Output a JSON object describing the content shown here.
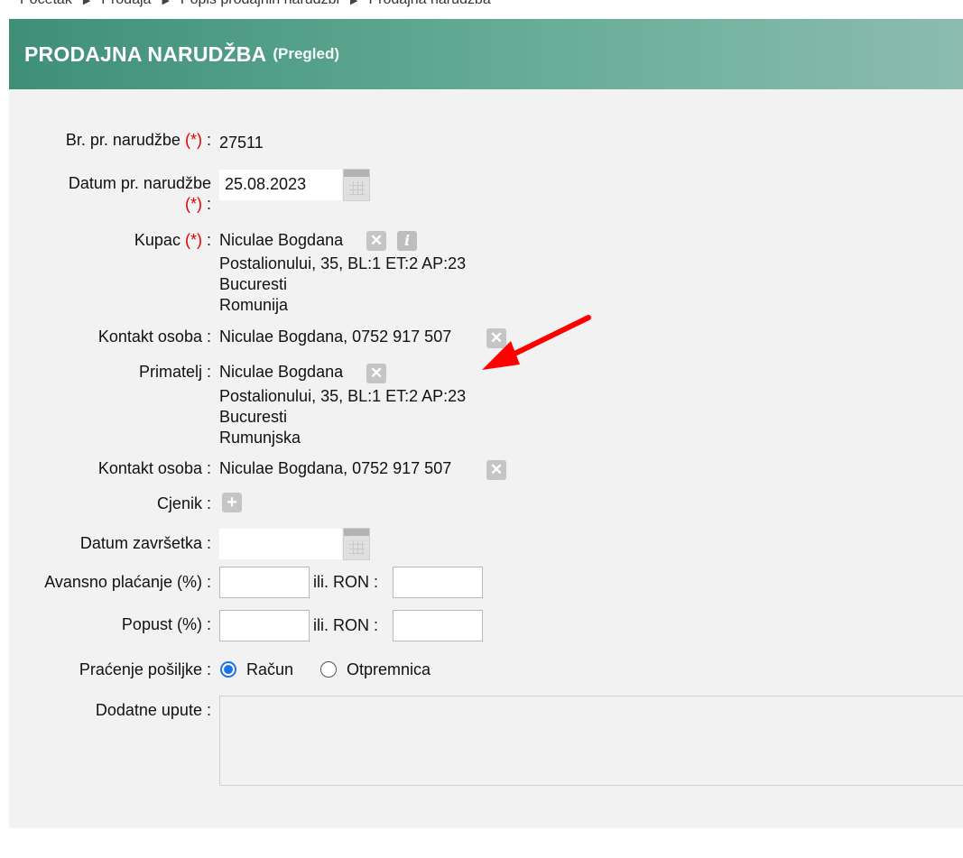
{
  "breadcrumb": [
    "Početak",
    "Prodaja",
    "Popis prodajnih narudžbi",
    "Prodajna narudžba"
  ],
  "header": {
    "title": "PRODAJNA NARUDŽBA",
    "mode": "(Pregled)"
  },
  "form": {
    "order_no": {
      "label": "Br. pr. narudžbe",
      "required": "(*)",
      "value": "27511"
    },
    "order_date": {
      "label_line1": "Datum pr. narudžbe",
      "required": "(*)",
      "value": "25.08.2023"
    },
    "customer": {
      "label": "Kupac",
      "required": "(*)",
      "name": "Niculae Bogdana",
      "address": "Postalionului, 35, BL:1 ET:2 AP:23",
      "city": "Bucuresti",
      "country": "Romunija"
    },
    "contact1": {
      "label": "Kontakt osoba",
      "value": "Niculae Bogdana, 0752 917 507"
    },
    "recipient": {
      "label": "Primatelj",
      "name": "Niculae Bogdana",
      "address": "Postalionului, 35, BL:1 ET:2 AP:23",
      "city": "Bucuresti",
      "country": "Rumunjska"
    },
    "contact2": {
      "label": "Kontakt osoba",
      "value": "Niculae Bogdana, 0752 917 507"
    },
    "pricelist": {
      "label": "Cjenik"
    },
    "completion_date": {
      "label": "Datum završetka",
      "value": ""
    },
    "advance": {
      "label": "Avansno plaćanje (%)",
      "or_label": "ili. RON",
      "percent": "",
      "amount": ""
    },
    "discount": {
      "label": "Popust (%)",
      "or_label": "ili. RON",
      "percent": "",
      "amount": ""
    },
    "tracking": {
      "label": "Praćenje pošiljke",
      "options": [
        "Račun",
        "Otpremnica"
      ],
      "selected": "Račun"
    },
    "notes": {
      "label": "Dodatne upute",
      "value": ""
    },
    "colon": ":"
  },
  "icons": {
    "clear": "clear-x-icon",
    "info": "info-icon",
    "add": "plus-icon",
    "calendar": "calendar-icon"
  },
  "colors": {
    "header_start": "#3f8f78",
    "header_end": "#8cbcb0",
    "required": "#e00000",
    "annotation_arrow": "#ff0000",
    "radio_selected": "#1a73e8"
  }
}
